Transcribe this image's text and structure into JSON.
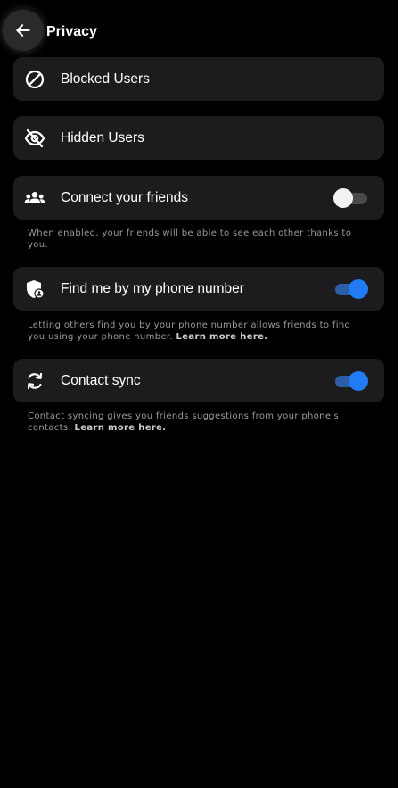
{
  "header": {
    "title": "Privacy",
    "back_icon": "arrow-left-icon"
  },
  "items": {
    "blocked": {
      "label": "Blocked Users",
      "icon": "block-icon"
    },
    "hidden": {
      "label": "Hidden Users",
      "icon": "eye-off-icon"
    },
    "connect": {
      "label": "Connect your friends",
      "icon": "group-icon",
      "enabled": false,
      "helper": "When enabled, your friends will be able to see each other thanks to you."
    },
    "phone": {
      "label": "Find me by my phone number",
      "icon": "shield-user-icon",
      "enabled": true,
      "helper": "Letting others find you by your phone number allows friends to find you using your phone number.",
      "helper_link": "Learn more here."
    },
    "sync": {
      "label": "Contact sync",
      "icon": "sync-icon",
      "enabled": true,
      "helper": "Contact syncing gives you friends suggestions from your phone's contacts.",
      "helper_link": "Learn more here."
    }
  },
  "colors": {
    "background": "#000000",
    "card": "#1c1c1e",
    "toggle_on_knob": "#1f7cf5",
    "toggle_on_track": "#2b5ea6",
    "toggle_off_knob": "#f2f2f2",
    "toggle_off_track": "#4a4a4c",
    "helper_text": "#9a9aa0"
  }
}
